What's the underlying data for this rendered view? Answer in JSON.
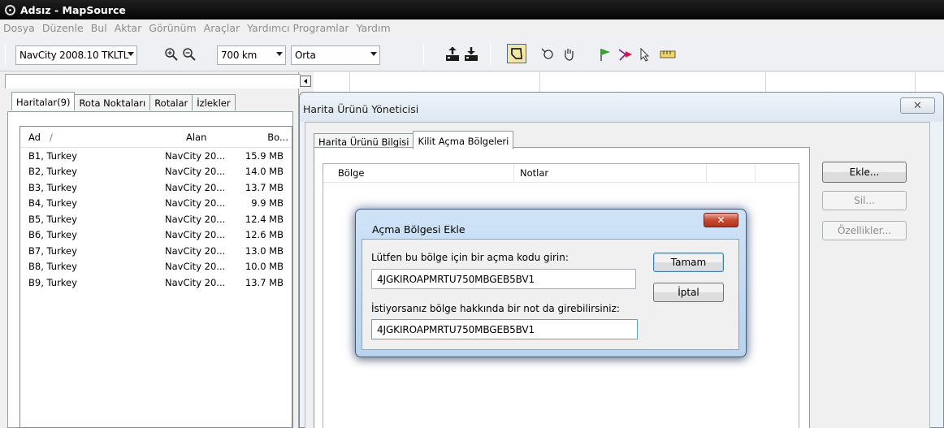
{
  "window": {
    "title": "Adsız - MapSource"
  },
  "menu": [
    "Dosya",
    "Düzenle",
    "Bul",
    "Aktar",
    "Görünüm",
    "Araçlar",
    "Yardımcı Programlar",
    "Yardım"
  ],
  "toolbar": {
    "map_product": "NavCity 2008.10 TKLTL",
    "zoom_level": "700 km",
    "detail": "Orta"
  },
  "left_tabs": [
    "Haritalar(9)",
    "Rota Noktaları",
    "Rotalar",
    "İzlekler"
  ],
  "maps_table": {
    "headers": [
      "Ad",
      "/",
      "Alan",
      "Bo..."
    ],
    "rows": [
      [
        "B1, Turkey",
        "NavCity 20...",
        "15.9 MB"
      ],
      [
        "B2, Turkey",
        "NavCity 20...",
        "14.0 MB"
      ],
      [
        "B3, Turkey",
        "NavCity 20...",
        "13.7 MB"
      ],
      [
        "B4, Turkey",
        "NavCity 20...",
        "9.9 MB"
      ],
      [
        "B5, Turkey",
        "NavCity 20...",
        "12.4 MB"
      ],
      [
        "B6, Turkey",
        "NavCity 20...",
        "12.6 MB"
      ],
      [
        "B7, Turkey",
        "NavCity 20...",
        "13.0 MB"
      ],
      [
        "B8, Turkey",
        "NavCity 20...",
        "10.0 MB"
      ],
      [
        "B9, Turkey",
        "NavCity 20...",
        "13.7 MB"
      ]
    ]
  },
  "product_manager": {
    "title": "Harita Ürünü Yöneticisi",
    "tabs": [
      "Harita Ürünü Bilgisi",
      "Kilit Açma Bölgeleri"
    ],
    "columns": [
      "Bölge",
      "Notlar"
    ],
    "buttons": {
      "add": "Ekle...",
      "delete": "Sil...",
      "properties": "Özellikler..."
    }
  },
  "unlock_dialog": {
    "title": "Açma Bölgesi Ekle",
    "code_label": "Lütfen bu bölge için bir açma kodu girin:",
    "code_value": "4JGKIROAPMRTU750MBGEB5BV1",
    "note_label": "İstiyorsanız bölge hakkında bir not da girebilirsiniz:",
    "note_value": "4JGKIROAPMRTU750MBGEB5BV1",
    "ok": "Tamam",
    "cancel": "İptal"
  }
}
